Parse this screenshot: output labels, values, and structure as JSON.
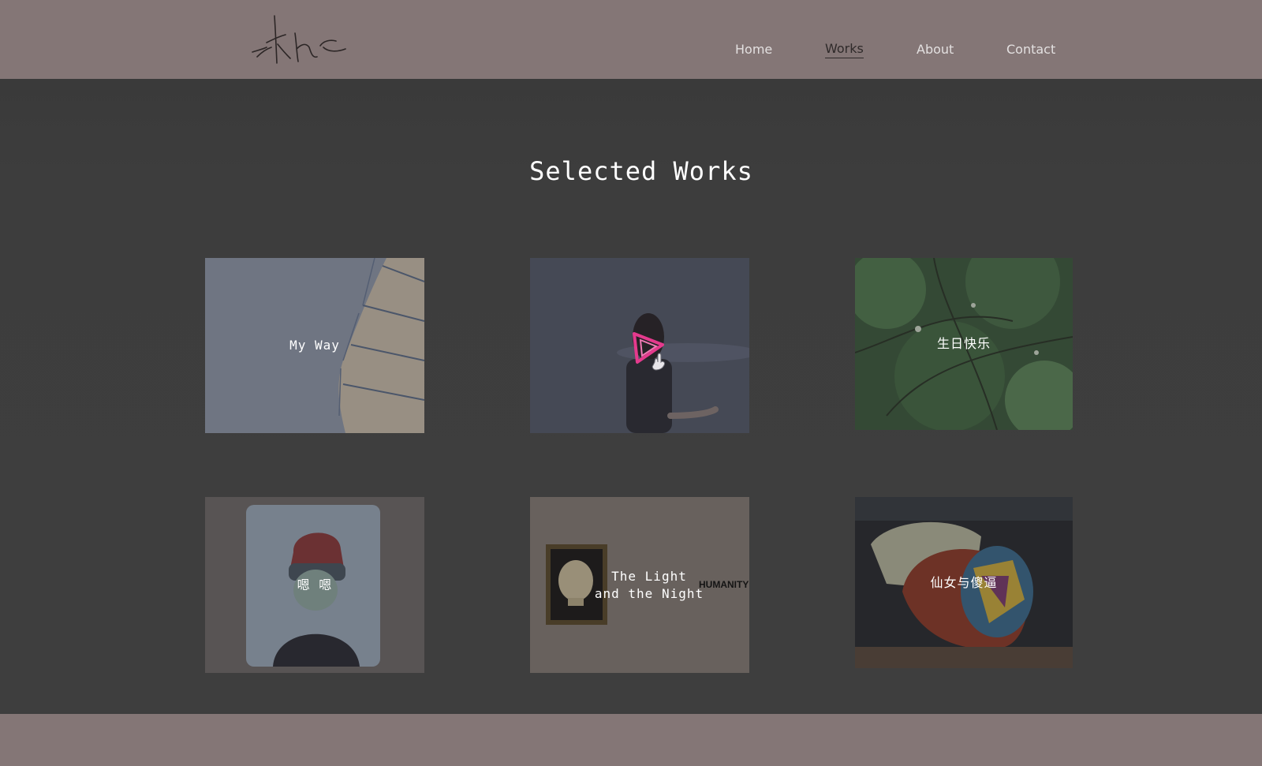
{
  "header": {
    "logo_alt": "logo signature",
    "nav": [
      {
        "label": "Home",
        "active": false
      },
      {
        "label": "Works",
        "active": true
      },
      {
        "label": "About",
        "active": false
      },
      {
        "label": "Contact",
        "active": false
      }
    ]
  },
  "main": {
    "title": "Selected Works",
    "works": [
      {
        "label": "My Way"
      },
      {
        "label": ""
      },
      {
        "label": "生日快乐"
      },
      {
        "label": "嗯 嗯"
      },
      {
        "label": "The Light\nand the Night",
        "poster_text": "HUMANITY"
      },
      {
        "label": "仙女与傻逼"
      }
    ]
  },
  "colors": {
    "header_bg": "#847676",
    "page_bg": "#3d3d3d",
    "accent_play": "#e43a8d"
  },
  "icons": {
    "video_card": "play-triangle-icon"
  }
}
